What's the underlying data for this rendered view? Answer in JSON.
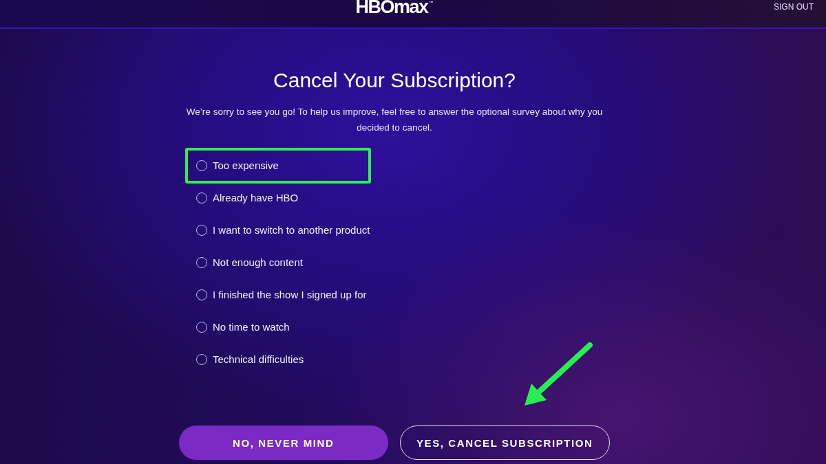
{
  "header": {
    "logo": "HBOmax$^{™}$",
    "sign_out": "SIGN OUT"
  },
  "dialog": {
    "title": "Cancel Your Subscription?",
    "message": "We’re sorry to see you go! To help us improve, feel free to answer the optional survey about why you decided to cancel.",
    "options": [
      {
        "label": "Too expensive",
        "selected": false,
        "highlighted": true
      },
      {
        "label": "Already have HBO",
        "selected": false,
        "highlighted": false
      },
      {
        "label": "I want to switch to another product",
        "selected": false,
        "highlighted": false
      },
      {
        "label": "Not enough content",
        "selected": false,
        "highlighted": false
      },
      {
        "label": "I finished the show I signed up for",
        "selected": false,
        "highlighted": false
      },
      {
        "label": "No time to watch",
        "selected": false,
        "highlighted": false
      },
      {
        "label": "Technical difficulties",
        "selected": false,
        "highlighted": false
      }
    ],
    "buttons": [
      {
        "label": "NO, NEVER MIND",
        "kind": "primary"
      },
      {
        "label": "YES, CANCEL SUBSCRIPTION",
        "kind": "outline"
      }
    ]
  },
  "annotations": [
    {
      "kind": "arrow"
    }
  ]
}
